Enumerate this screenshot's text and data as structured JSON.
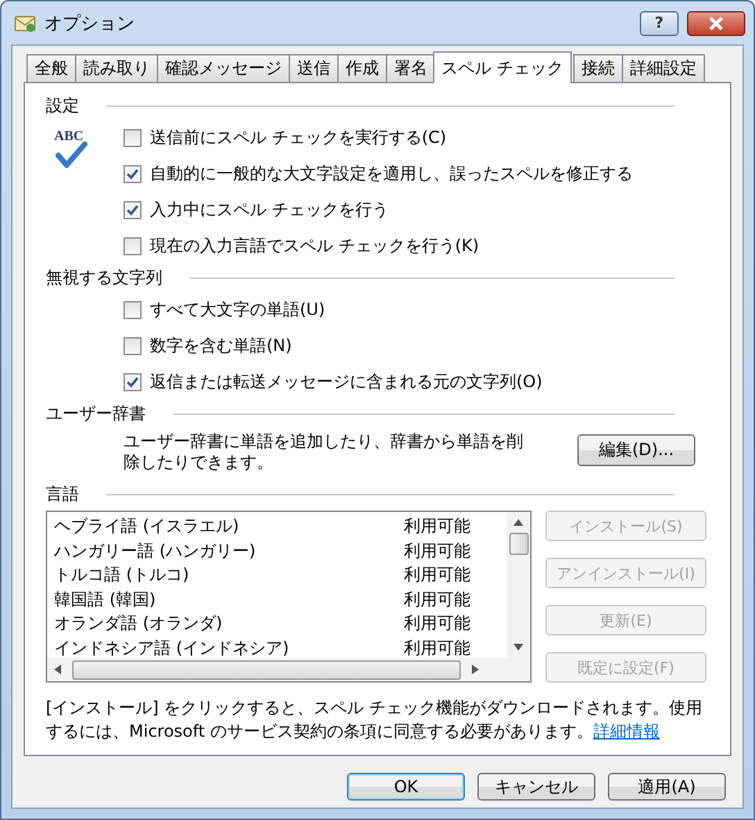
{
  "window": {
    "title": "オプション",
    "help_button": "?"
  },
  "tabs": [
    {
      "label": "全般",
      "selected": false
    },
    {
      "label": "読み取り",
      "selected": false
    },
    {
      "label": "確認メッセージ",
      "selected": false
    },
    {
      "label": "送信",
      "selected": false
    },
    {
      "label": "作成",
      "selected": false
    },
    {
      "label": "署名",
      "selected": false
    },
    {
      "label": "スペル チェック",
      "selected": true
    },
    {
      "label": "接続",
      "selected": false
    },
    {
      "label": "詳細設定",
      "selected": false
    }
  ],
  "settings": {
    "heading": "設定",
    "icon_text": "ABC",
    "options": [
      {
        "label": "送信前にスペル チェックを実行する(C)",
        "checked": false
      },
      {
        "label": "自動的に一般的な大文字設定を適用し、誤ったスペルを修正する",
        "checked": true
      },
      {
        "label": "入力中にスペル チェックを行う",
        "checked": true
      },
      {
        "label": "現在の入力言語でスペル チェックを行う(K)",
        "checked": false
      }
    ]
  },
  "ignore": {
    "heading": "無視する文字列",
    "options": [
      {
        "label": "すべて大文字の単語(U)",
        "checked": false
      },
      {
        "label": "数字を含む単語(N)",
        "checked": false
      },
      {
        "label": "返信または転送メッセージに含まれる元の文字列(O)",
        "checked": true
      }
    ]
  },
  "user_dictionary": {
    "heading": "ユーザー辞書",
    "description": "ユーザー辞書に単語を追加したり、辞書から単語を削除したりできます。",
    "button": "編集(D)..."
  },
  "languages": {
    "heading": "言語",
    "items": [
      {
        "name": "ヘブライ語 (イスラエル)",
        "status": "利用可能"
      },
      {
        "name": "ハンガリー語 (ハンガリー)",
        "status": "利用可能"
      },
      {
        "name": "トルコ語 (トルコ)",
        "status": "利用可能"
      },
      {
        "name": "韓国語 (韓国)",
        "status": "利用可能"
      },
      {
        "name": "オランダ語 (オランダ)",
        "status": "利用可能"
      },
      {
        "name": "インドネシア語 (インドネシア)",
        "status": "利用可能"
      }
    ],
    "buttons": [
      {
        "label": "インストール(S)",
        "disabled": true
      },
      {
        "label": "アンインストール(I)",
        "disabled": true
      },
      {
        "label": "更新(E)",
        "disabled": true
      },
      {
        "label": "既定に設定(F)",
        "disabled": true
      }
    ]
  },
  "footer": {
    "text": "[インストール] をクリックすると、スペル チェック機能がダウンロードされます。使用するには、Microsoft のサービス契約の条項に同意する必要があります。",
    "link": "詳細情報"
  },
  "buttons": [
    {
      "label": "OK",
      "default": true
    },
    {
      "label": "キャンセル",
      "default": false
    },
    {
      "label": "適用(A)",
      "default": false
    }
  ]
}
